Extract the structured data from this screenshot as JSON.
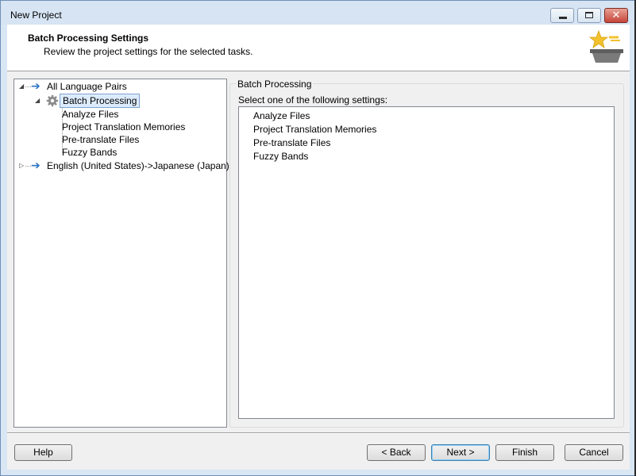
{
  "window": {
    "title": "New Project"
  },
  "header": {
    "title": "Batch Processing Settings",
    "subtitle": "Review the project settings for the selected tasks."
  },
  "tree": {
    "root": "All Language Pairs",
    "selected": "Batch Processing",
    "children": [
      "Analyze Files",
      "Project Translation Memories",
      "Pre-translate Files",
      "Fuzzy Bands"
    ],
    "language_pair": "English (United States)->Japanese (Japan)"
  },
  "panel": {
    "group_title": "Batch Processing",
    "instruction": "Select one of the following settings:",
    "items": [
      "Analyze Files",
      "Project Translation Memories",
      "Pre-translate Files",
      "Fuzzy Bands"
    ]
  },
  "buttons": {
    "help": "Help",
    "back": "< Back",
    "next": "Next >",
    "finish": "Finish",
    "cancel": "Cancel"
  },
  "colors": {
    "accent_blue": "#2b73c4",
    "selection_bg": "#dcebfc",
    "close_red": "#c6453a"
  }
}
